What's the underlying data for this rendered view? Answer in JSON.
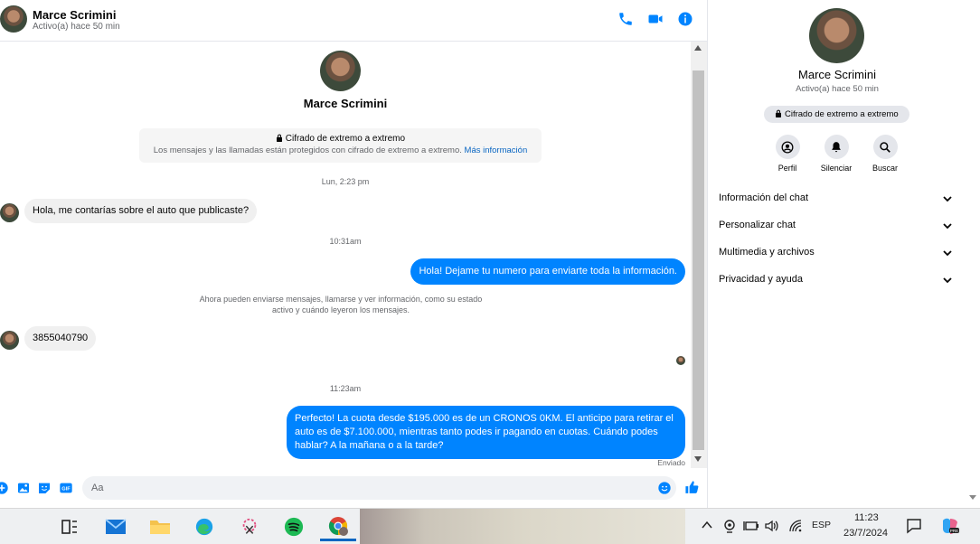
{
  "contact": {
    "name": "Marce Scrimini",
    "status": "Activo(a) hace 50 min"
  },
  "chat": {
    "encryption_title": "Cifrado de extremo a extremo",
    "encryption_desc": "Los mensajes y las llamadas están protegidos con cifrado de extremo a extremo.",
    "encryption_link": "Más información",
    "messages": [
      {
        "kind": "timestamp",
        "text": "Lun, 2:23 pm"
      },
      {
        "kind": "incoming",
        "text": "Hola, me contarías sobre el auto que publicaste?"
      },
      {
        "kind": "timestamp",
        "text": "10:31am"
      },
      {
        "kind": "outgoing",
        "text": "Hola! Dejame tu numero  para enviarte toda la información."
      },
      {
        "kind": "notice",
        "text": "Ahora pueden enviarse mensajes, llamarse y ver información, como su estado activo y cuándo leyeron los mensajes."
      },
      {
        "kind": "incoming",
        "text": "3855040790"
      },
      {
        "kind": "timestamp",
        "text": "11:23am"
      },
      {
        "kind": "outgoing",
        "text": "Perfecto! La cuota desde $195.000 es de un CRONOS 0KM. El anticipo para retirar el auto es de $7.100.000, mientras tanto podes ir pagando en cuotas. Cuándo podes hablar? A la mañana o a la tarde?"
      }
    ],
    "sent_label": "Enviado"
  },
  "composer": {
    "placeholder": "Aa"
  },
  "right_panel": {
    "name": "Marce Scrimini",
    "status": "Activo(a) hace 50 min",
    "encryption_badge": "Cifrado de extremo a extremo",
    "actions": [
      {
        "label": "Perfil",
        "icon": "profile-icon"
      },
      {
        "label": "Silenciar",
        "icon": "bell-icon"
      },
      {
        "label": "Buscar",
        "icon": "search-icon"
      }
    ],
    "sections": [
      {
        "label": "Información del chat"
      },
      {
        "label": "Personalizar chat"
      },
      {
        "label": "Multimedia y archivos"
      },
      {
        "label": "Privacidad y ayuda"
      }
    ]
  },
  "taskbar": {
    "language": "ESP",
    "time": "11:23",
    "date": "23/7/2024",
    "apps": [
      "task-view-icon",
      "mail-icon",
      "file-explorer-icon",
      "edge-icon",
      "snipping-tool-icon",
      "spotify-icon",
      "chrome-icon"
    ]
  },
  "colors": {
    "accent": "#0084ff",
    "link": "#0a66c2",
    "bubble_in": "#f0f0f0",
    "secondary_text": "#65676b"
  }
}
